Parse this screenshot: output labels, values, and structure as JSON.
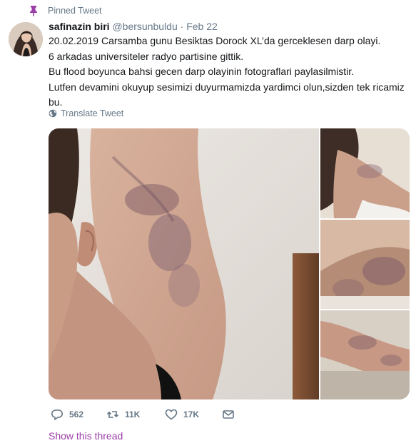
{
  "pinned_label": "Pinned Tweet",
  "author": {
    "name": "safinazin biri",
    "handle": "@bersunbuldu",
    "separator": "·",
    "date": "Feb 22"
  },
  "tweet_lines": [
    "20.02.2019 Carsamba gunu Besiktas Dorock XL’da gerceklesen darp olayi.",
    "6 arkadas universiteler radyo partisine gittik.",
    "Bu flood boyunca bahsi gecen darp olayinin fotograflari paylasilmistir.",
    "Lutfen devamini okuyup sesimizi duyurmamizda yardimci olun,sizden tek ricamiz bu."
  ],
  "translate_label": "Translate Tweet",
  "actions": {
    "reply_count": "562",
    "retweet_count": "11K",
    "like_count": "17K"
  },
  "show_thread_label": "Show this thread",
  "colors": {
    "accent": "#9b3ea7",
    "muted": "#657786",
    "text": "#14171a"
  },
  "icons": [
    "pin-icon",
    "globe-icon",
    "reply-icon",
    "retweet-icon",
    "like-icon",
    "message-icon"
  ]
}
